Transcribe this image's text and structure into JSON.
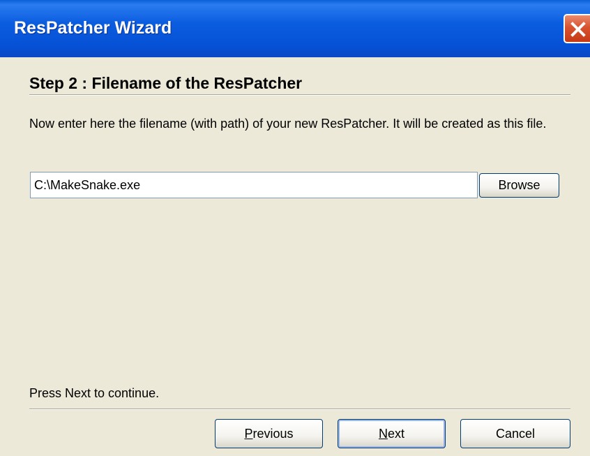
{
  "window": {
    "title": "ResPatcher Wizard"
  },
  "step": {
    "heading": "Step 2 : Filename of the ResPatcher",
    "instructions": "Now enter here the filename (with path) of your new ResPatcher. It will be created as this file."
  },
  "file_input": {
    "value": "C:\\MakeSnake.exe"
  },
  "buttons": {
    "browse": "Browse",
    "previous_accel": "P",
    "previous_rest": "revious",
    "next_accel": "N",
    "next_rest": "ext",
    "cancel": "Cancel"
  },
  "footer": {
    "status": "Press Next to continue."
  },
  "colors": {
    "titlebar": "#0651d6",
    "close": "#c63a15",
    "background": "#ece9d8"
  }
}
